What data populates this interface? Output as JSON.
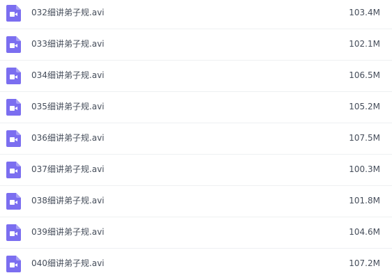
{
  "files": [
    {
      "name": "032细讲弟子规.avi",
      "size": "103.4M",
      "icon": "video-file-icon"
    },
    {
      "name": "033细讲弟子规.avi",
      "size": "102.1M",
      "icon": "video-file-icon"
    },
    {
      "name": "034细讲弟子规.avi",
      "size": "106.5M",
      "icon": "video-file-icon"
    },
    {
      "name": "035细讲弟子规.avi",
      "size": "105.2M",
      "icon": "video-file-icon"
    },
    {
      "name": "036细讲弟子规.avi",
      "size": "107.5M",
      "icon": "video-file-icon"
    },
    {
      "name": "037细讲弟子规.avi",
      "size": "100.3M",
      "icon": "video-file-icon"
    },
    {
      "name": "038细讲弟子规.avi",
      "size": "101.8M",
      "icon": "video-file-icon"
    },
    {
      "name": "039细讲弟子规.avi",
      "size": "104.6M",
      "icon": "video-file-icon"
    },
    {
      "name": "040细讲弟子规.avi",
      "size": "107.2M",
      "icon": "video-file-icon"
    }
  ],
  "colors": {
    "icon": "#7b6ef0",
    "text": "#454d5a",
    "divider": "#eef0f2"
  }
}
